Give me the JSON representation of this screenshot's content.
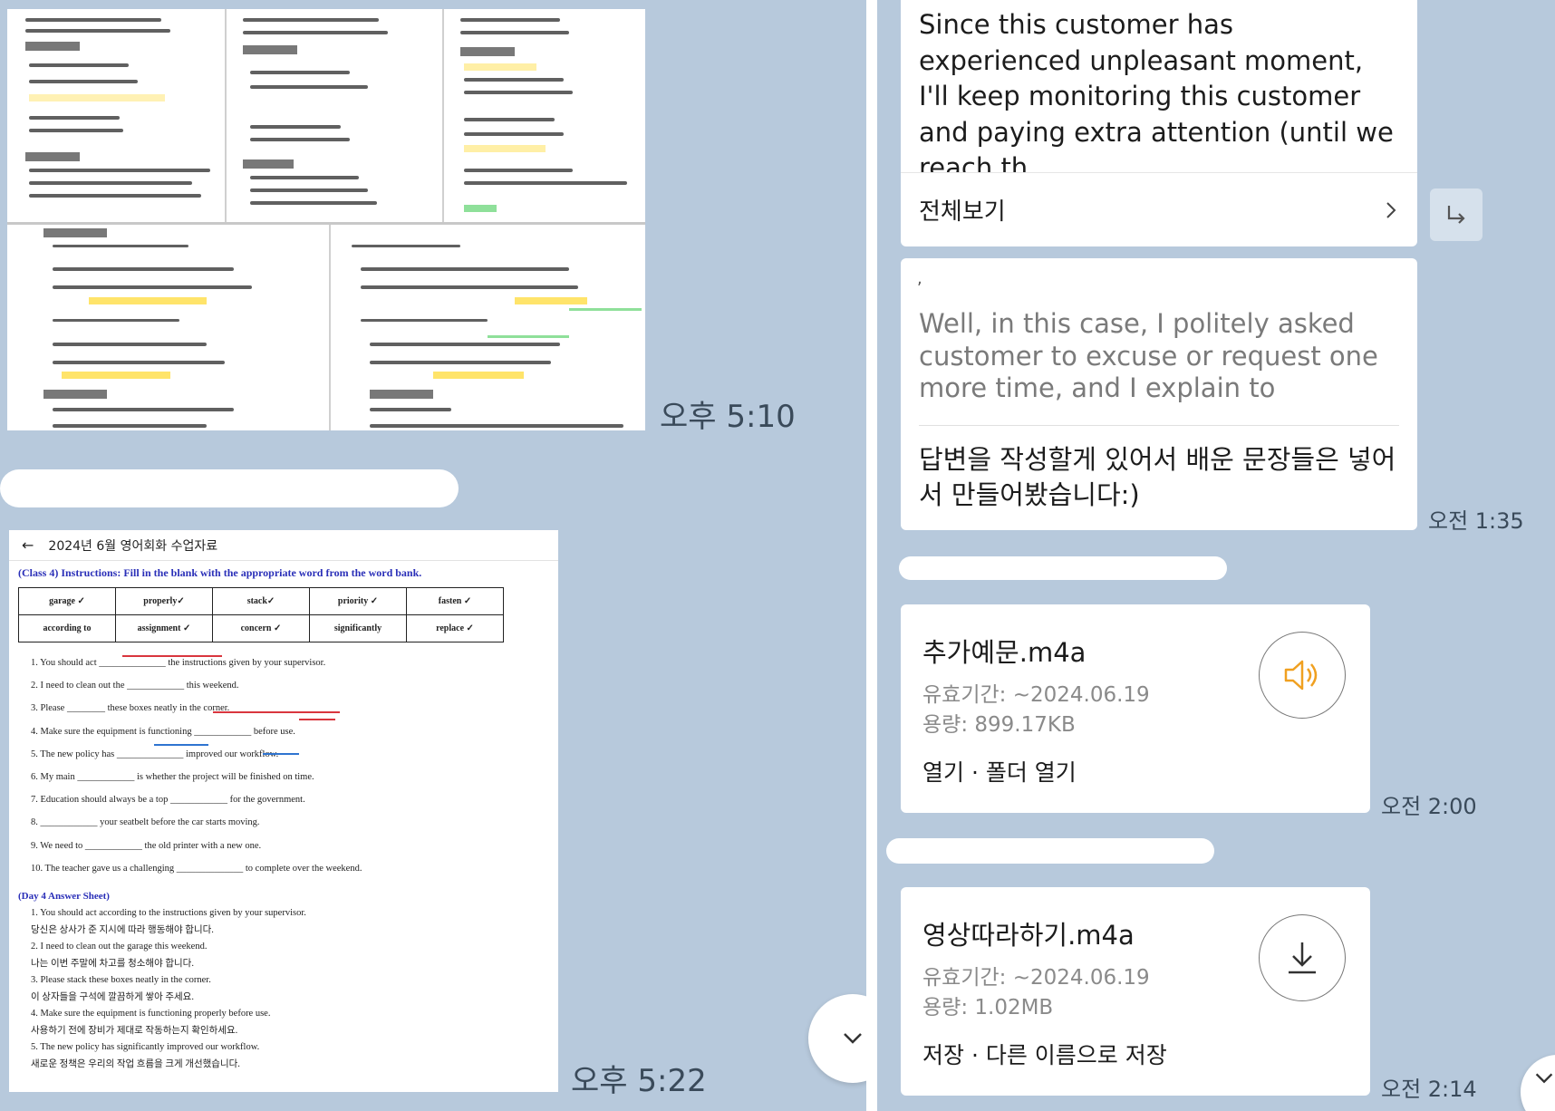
{
  "left": {
    "image1_time": "오후 5:10",
    "image2_time": "오후 5:22",
    "worksheet": {
      "header_title": "2024년 6월 영어회화 수업자료",
      "instructions": "(Class 4) Instructions: Fill in the blank with the appropriate word from the word bank.",
      "word_bank": [
        [
          "garage ✓",
          "properly✓",
          "stack✓",
          "priority ✓",
          "fasten ✓"
        ],
        [
          "according to",
          "assignment ✓",
          "concern ✓",
          "significantly",
          "replace ✓"
        ]
      ],
      "questions": [
        "1. You should act ______________ the instructions given by your supervisor.",
        "2. I need to clean out the ____________ this weekend.",
        "3. Please ________ these boxes neatly in the corner.",
        "4. Make sure the equipment is functioning ____________ before use.",
        "5. The new policy has ______________ improved our workflow.",
        "6. My main ____________ is whether the project will be finished on time.",
        "7. Education should always be a top ____________ for the government.",
        "8. ____________ your seatbelt before the car starts moving.",
        "9. We need to ____________ the old printer with a new one.",
        "10. The teacher gave us a challenging ______________ to complete over the weekend."
      ],
      "answer_title": "(Day 4 Answer Sheet)",
      "answers": [
        "1. You should act according to the instructions given by your supervisor.",
        "당신은 상사가 준 지시에 따라 행동해야 합니다.",
        "2. I need to clean out the garage this weekend.",
        "나는 이번 주말에 차고를 청소해야 합니다.",
        "3. Please stack these boxes neatly in the corner.",
        "이 상자들을 구석에 깔끔하게 쌓아 주세요.",
        "4. Make sure the equipment is functioning properly before use.",
        "사용하기 전에 장비가 제대로 작동하는지 확인하세요.",
        "5. The new policy has significantly improved our workflow.",
        "새로운 정책은 우리의 작업 흐름을 크게 개선했습니다."
      ]
    }
  },
  "right": {
    "card1": {
      "text": "Since this customer has experienced unpleasant moment, I'll keep monitoring this customer and paying extra attention (until we reach th...",
      "view_all": "전체보기"
    },
    "card2": {
      "quote_mark": ",",
      "quote": "Well, in this case, I politely asked customer  to excuse or request one more time, and I explain to",
      "reply": "답변을 작성할게 있어서 배운 문장들은 넣어서 만들어봤습니다:)",
      "time": "오전 1:35"
    },
    "file1": {
      "name": "추가예문.m4a",
      "expiry": "유효기간: ~2024.06.19",
      "size": "용량: 899.17KB",
      "actions": "열기 · 폴더 열기",
      "time": "오전 2:00"
    },
    "file2": {
      "name": "영상따라하기.m4a",
      "expiry": "유효기간: ~2024.06.19",
      "size": "용량: 1.02MB",
      "actions": "저장 · 다른 이름으로 저장",
      "time": "오전 2:14"
    }
  },
  "colors": {
    "chat_background": "#b7c9dc",
    "bubble": "#ffffff",
    "speaker_icon": "#f0a020",
    "worksheet_blue": "#2a2fb8"
  },
  "icons": [
    "back-arrow-icon",
    "chevron-right-icon",
    "forward-arrow-icon",
    "speaker-icon",
    "download-icon",
    "chevron-down-icon"
  ]
}
